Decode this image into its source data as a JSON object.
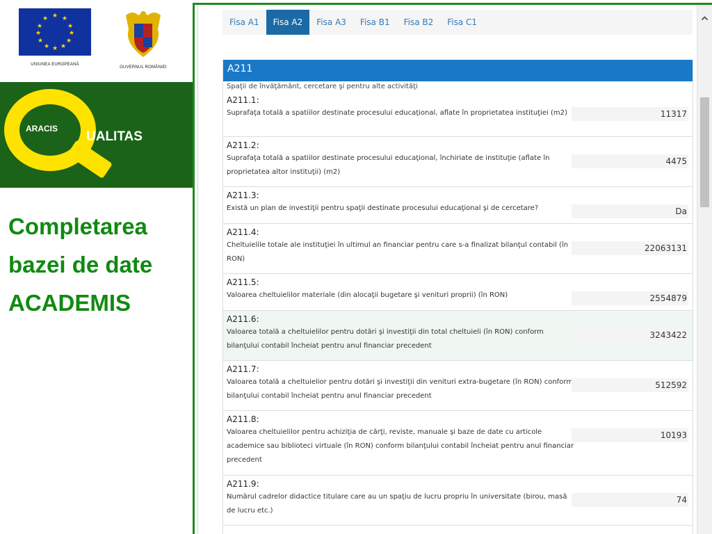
{
  "logos": {
    "eu_caption": "UNIUNEA EUROPEANĂ",
    "gov_caption": "GUVERNUL ROMÂNIEI"
  },
  "brand": {
    "aracis": "ARACIS",
    "qualitas": "UALITAS",
    "green": "#1b6318",
    "yellow": "#ffe300"
  },
  "slide": {
    "title_lines": [
      "Completarea",
      "bazei de date",
      "ACADEMIS"
    ],
    "title_color": "#118a11"
  },
  "tabs": [
    {
      "label": "Fisa A1",
      "active": false
    },
    {
      "label": "Fisa A2",
      "active": true
    },
    {
      "label": "Fisa A3",
      "active": false
    },
    {
      "label": "Fisa B1",
      "active": false
    },
    {
      "label": "Fisa B2",
      "active": false
    },
    {
      "label": "Fisa C1",
      "active": false
    }
  ],
  "panel": {
    "title": "A211",
    "subtitle": "Spaţii de învăţământ, cercetare şi pentru alte activităţi",
    "header_color": "#1a79c7"
  },
  "rows": [
    {
      "code": "A211.1:",
      "desc": "Suprafaţa totală a spatiilor destinate procesului educaţional, aflate în proprietatea instituţiei (m2)",
      "value": "11317"
    },
    {
      "code": "A211.2:",
      "desc": "Suprafaţa totală a spatiilor destinate procesului educaţional, închiriate de instituţie (aflate în proprietatea altor instituţii) (m2)",
      "value": "4475"
    },
    {
      "code": "A211.3:",
      "desc": "Există un plan de investiţii pentru spaţii destinate procesului educaţional şi de cercetare?",
      "value": "Da"
    },
    {
      "code": "A211.4:",
      "desc": "Cheltuielile totale ale instituţiei în ultimul an financiar pentru care s-a finalizat bilanţul contabil (în RON)",
      "value": "22063131"
    },
    {
      "code": "A211.5:",
      "desc": "Valoarea cheltuielilor materiale (din alocaţii bugetare şi venituri proprii) (în RON)",
      "value": "2554879"
    },
    {
      "code": "A211.6:",
      "desc": "Valoarea totală a cheltuielilor pentru dotări şi investiţii din total cheltuieli (în RON) conform bilanţului contabil încheiat pentru anul financiar precedent",
      "value": "3243422"
    },
    {
      "code": "A211.7:",
      "desc": "Valoarea totală a cheltuielior pentru dotări şi investiţii din venituri extra-bugetare (în RON) conform bilanţului contabil încheiat pentru anul financiar precedent",
      "value": "512592"
    },
    {
      "code": "A211.8:",
      "desc": "Valoarea cheltuielilor pentru achiziţia de cărţi, reviste, manuale şi baze de date cu articole academice sau biblioteci virtuale (în RON) conform bilanţului contabil încheiat pentru anul financiar precedent",
      "value": "10193"
    },
    {
      "code": "A211.9:",
      "desc": "Numărul cadrelor didactice titulare care au un spaţiu de lucru propriu în universitate (birou, masă de lucru etc.)",
      "value": "74"
    }
  ]
}
